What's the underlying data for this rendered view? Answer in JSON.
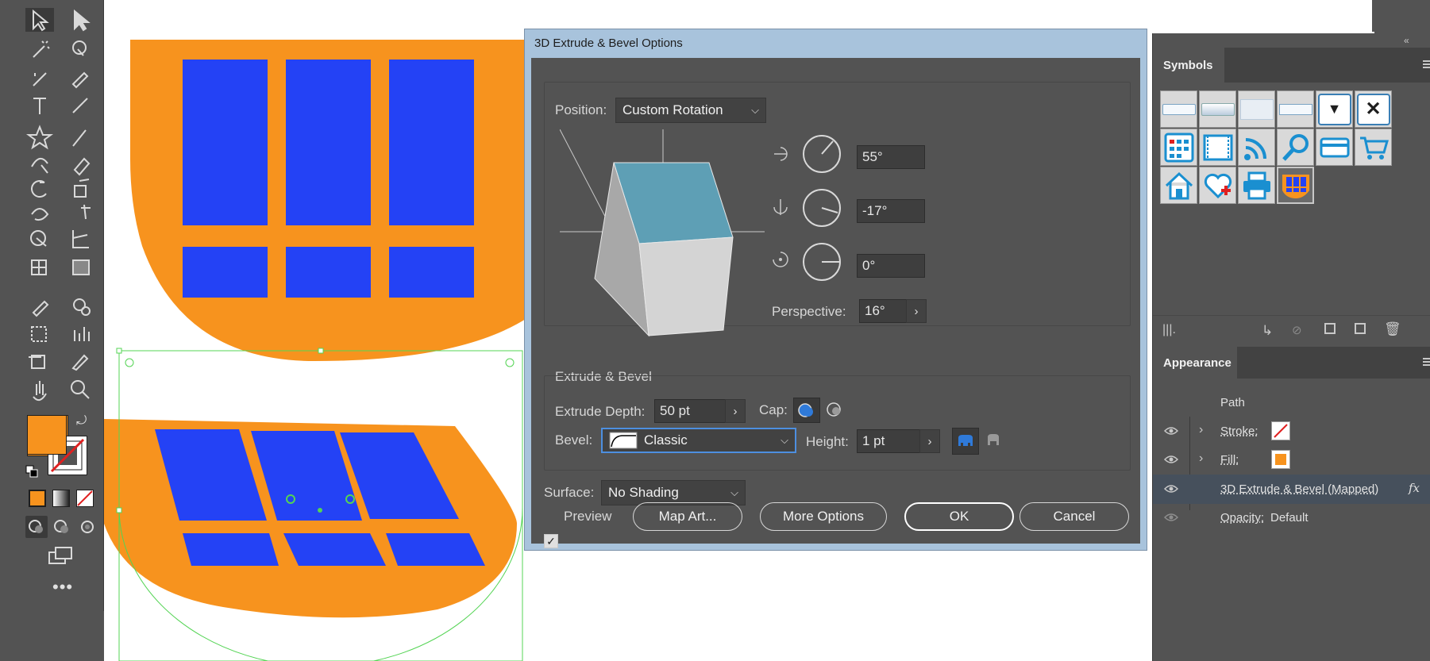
{
  "dialog": {
    "title": "3D Extrude & Bevel Options",
    "position_label": "Position:",
    "position_value": "Custom Rotation",
    "rotation_x": "55°",
    "rotation_y": "-17°",
    "rotation_z": "0°",
    "perspective_label": "Perspective:",
    "perspective_value": "16°",
    "extrude_section_label": "Extrude & Bevel",
    "extrude_depth_label": "Extrude Depth:",
    "extrude_depth_value": "50 pt",
    "cap_label": "Cap:",
    "bevel_label": "Bevel:",
    "bevel_value": "Classic",
    "height_label": "Height:",
    "height_value": "1 pt",
    "surface_label": "Surface:",
    "surface_value": "No Shading",
    "preview_label": "Preview",
    "preview_checked": true,
    "map_art_label": "Map Art...",
    "more_options_label": "More Options",
    "ok_label": "OK",
    "cancel_label": "Cancel"
  },
  "symbols_panel": {
    "tab_label": "Symbols",
    "icons": [
      "button-flat-icon",
      "button-gradient-icon",
      "button-light-icon",
      "button-dropdown-icon",
      "dropdown-arrow-icon",
      "close-x-icon",
      "calendar-icon",
      "filmstrip-icon",
      "rss-icon",
      "magnifier-icon",
      "credit-card-icon",
      "shopping-cart-icon",
      "home-icon",
      "heart-plus-icon",
      "printer-icon",
      "window-symbol-icon"
    ]
  },
  "appearance_panel": {
    "tab_label": "Appearance",
    "path_label": "Path",
    "stroke_label": "Stroke:",
    "fill_label": "Fill:",
    "effect_label": "3D Extrude & Bevel (Mapped)",
    "fx_label": "fx",
    "opacity_label": "Opacity:",
    "opacity_value": "Default"
  },
  "colors": {
    "accent_orange": "#f7931e",
    "window_blue": "#2442f5",
    "cube_top": "#5e9fb5",
    "selection_green": "#54d454",
    "dialog_bg": "#535353"
  }
}
